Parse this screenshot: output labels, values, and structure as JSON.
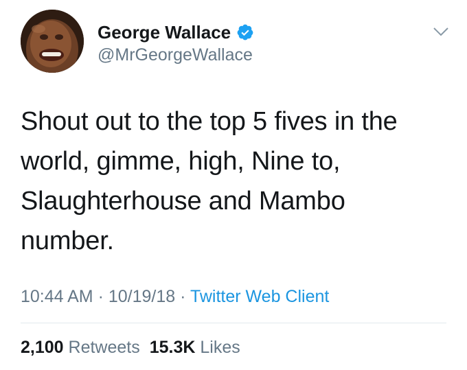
{
  "author": {
    "display_name": "George Wallace",
    "handle": "@MrGeorgeWallace",
    "verified": true
  },
  "tweet": {
    "text": "Shout out to the top 5 fives in the world, gimme, high, Nine to, Slaughterhouse and Mambo number."
  },
  "meta": {
    "time": "10:44 AM",
    "separator1": " · ",
    "date": "10/19/18",
    "separator2": " · ",
    "client": "Twitter Web Client"
  },
  "stats": {
    "retweets_count": "2,100",
    "retweets_label": "Retweets",
    "likes_count": "15.3K",
    "likes_label": "Likes"
  },
  "colors": {
    "text": "#14171a",
    "secondary": "#657786",
    "link": "#1b95e0",
    "verified": "#1da1f2",
    "divider": "#e1e8ed"
  },
  "icons": {
    "verified": "verified-badge-icon",
    "menu": "chevron-down-icon"
  }
}
